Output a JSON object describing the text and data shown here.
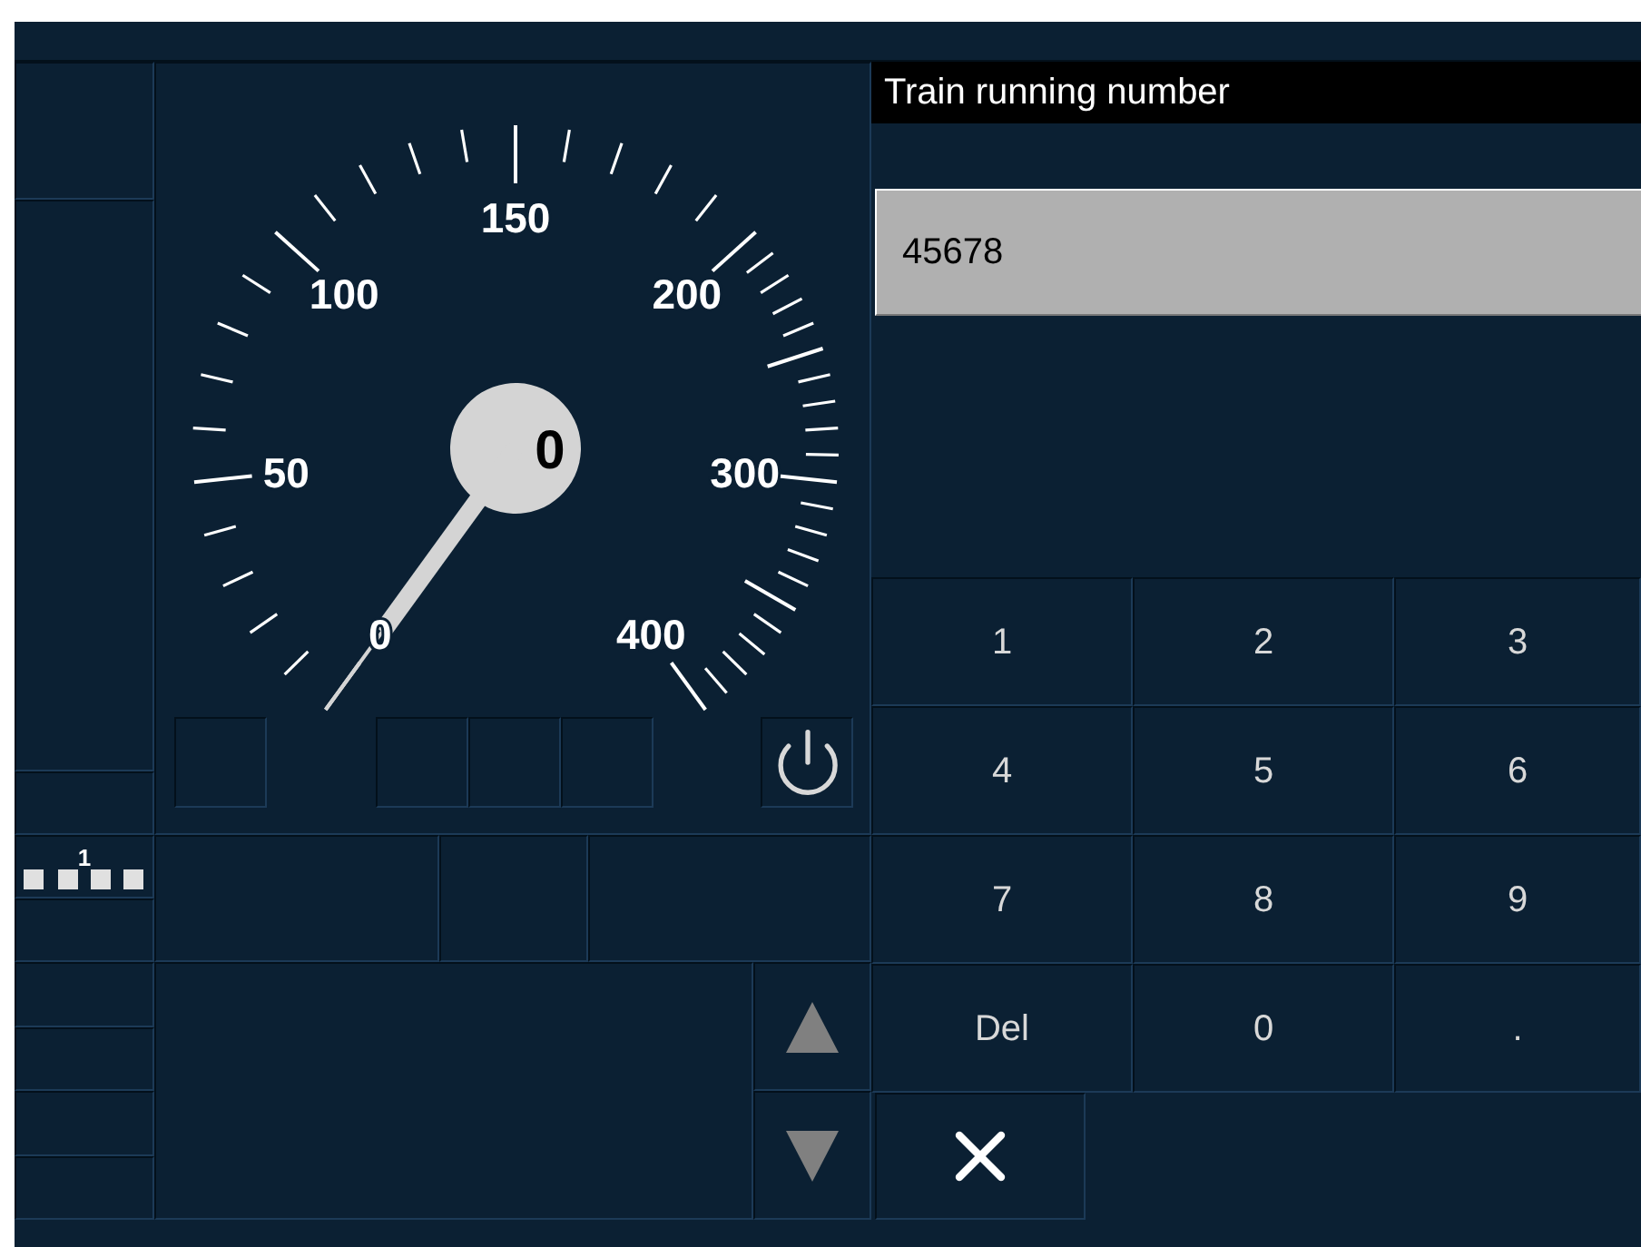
{
  "speedometer": {
    "labels": [
      "0",
      "50",
      "100",
      "150",
      "200",
      "300",
      "400"
    ],
    "digital_speed": "0"
  },
  "level_indicator": {
    "label": "1"
  },
  "entry": {
    "title": "Train running number",
    "value": "45678"
  },
  "keypad": [
    {
      "label": "1"
    },
    {
      "label": "2"
    },
    {
      "label": "3"
    },
    {
      "label": "4"
    },
    {
      "label": "5"
    },
    {
      "label": "6"
    },
    {
      "label": "7"
    },
    {
      "label": "8"
    },
    {
      "label": "9"
    },
    {
      "label": "Del"
    },
    {
      "label": "0"
    },
    {
      "label": "."
    }
  ]
}
